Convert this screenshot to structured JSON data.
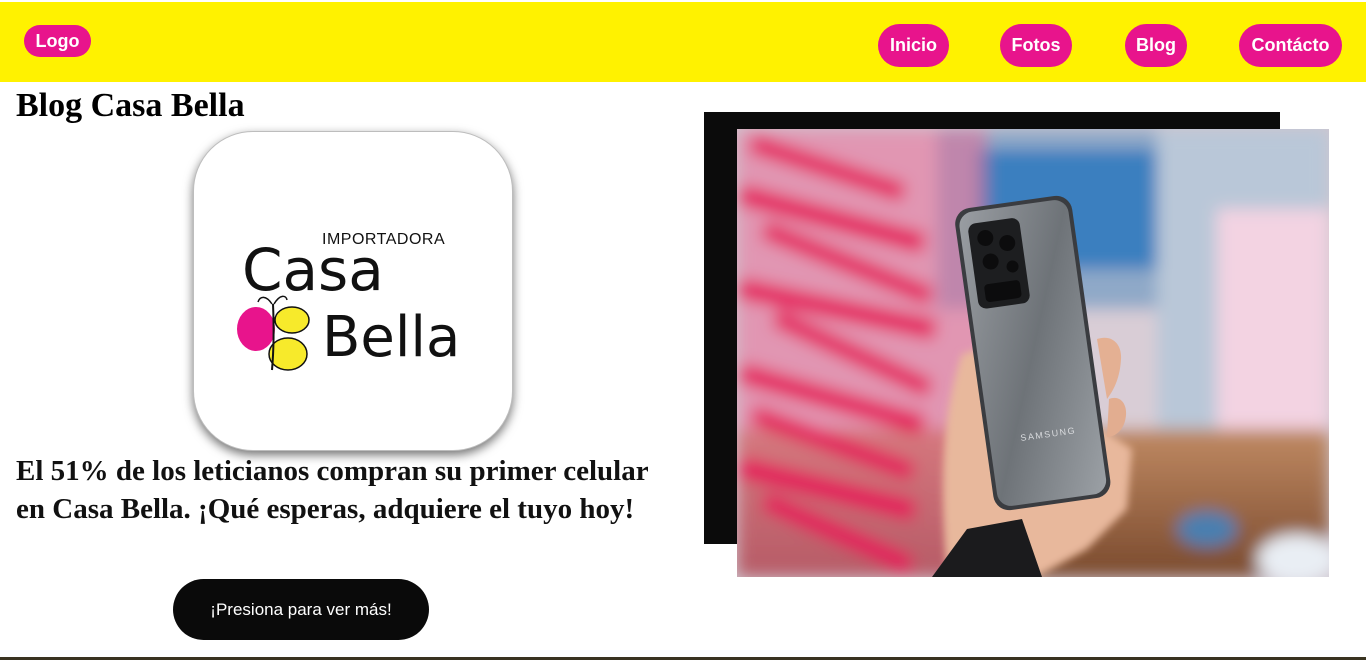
{
  "header": {
    "logo_label": "Logo",
    "nav": [
      {
        "label": "Inicio"
      },
      {
        "label": "Fotos"
      },
      {
        "label": "Blog"
      },
      {
        "label": "Contácto"
      }
    ]
  },
  "main": {
    "title": "Blog Casa Bella",
    "brand": {
      "line1": "IMPORTADORA",
      "line2": "Casa",
      "line3": "Bella"
    },
    "promo_text": "El 51% de los leticianos compran su primer celular en Casa Bella. ¡Qué esperas, adquiere el tuyo hoy!",
    "cta_label": "¡Presiona para ver más!",
    "photo": {
      "phone_brand": "SAMSUNG"
    }
  },
  "colors": {
    "header_bg": "#fff200",
    "accent_pink": "#e8148c",
    "butterfly_yellow": "#f7ea2b",
    "button_bg": "#0a0a0a"
  }
}
